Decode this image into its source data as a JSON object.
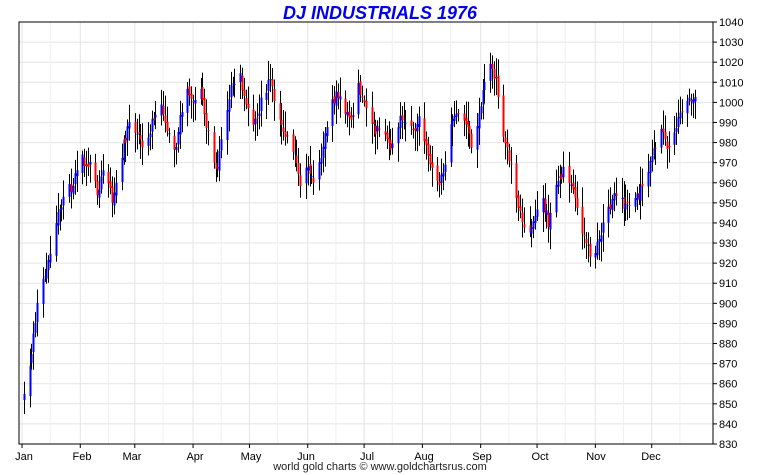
{
  "chart_data": {
    "type": "ohlc",
    "title": "DJ INDUSTRIALS 1976",
    "credit": "world gold charts © www.goldchartsrus.com",
    "y_axis": {
      "min": 830,
      "max": 1040,
      "step": 10,
      "side": "right",
      "ticks": [
        830,
        840,
        850,
        860,
        870,
        880,
        890,
        900,
        910,
        920,
        930,
        940,
        950,
        960,
        970,
        980,
        990,
        1000,
        1010,
        1020,
        1030,
        1040
      ]
    },
    "x_axis": {
      "months": [
        "Jan",
        "Feb",
        "Mar",
        "Apr",
        "May",
        "Jun",
        "Jul",
        "Aug",
        "Sep",
        "Oct",
        "Nov",
        "Dec"
      ]
    },
    "grid": true,
    "colors": {
      "title": "#0000ee",
      "up_bar": "#0000ff",
      "down_bar": "#ff0000",
      "wick": "#000000",
      "grid": "#e4e4e4"
    },
    "series": [
      {
        "close_path": [
          {
            "d": 1,
            "c": 852
          },
          {
            "d": 3,
            "c": 860
          },
          {
            "d": 6,
            "c": 885
          },
          {
            "d": 9,
            "c": 905
          },
          {
            "d": 13,
            "c": 915
          },
          {
            "d": 16,
            "c": 930
          },
          {
            "d": 20,
            "c": 948
          },
          {
            "d": 24,
            "c": 955
          },
          {
            "d": 28,
            "c": 962
          },
          {
            "d": 32,
            "c": 972
          },
          {
            "d": 36,
            "c": 968
          },
          {
            "d": 40,
            "c": 955
          },
          {
            "d": 44,
            "c": 970
          },
          {
            "d": 48,
            "c": 950
          },
          {
            "d": 53,
            "c": 975
          },
          {
            "d": 57,
            "c": 990
          },
          {
            "d": 61,
            "c": 985
          },
          {
            "d": 65,
            "c": 975
          },
          {
            "d": 69,
            "c": 990
          },
          {
            "d": 73,
            "c": 1000
          },
          {
            "d": 77,
            "c": 985
          },
          {
            "d": 82,
            "c": 978
          },
          {
            "d": 87,
            "c": 1010
          },
          {
            "d": 91,
            "c": 1000
          },
          {
            "d": 95,
            "c": 1005
          },
          {
            "d": 99,
            "c": 985
          },
          {
            "d": 103,
            "c": 965
          },
          {
            "d": 107,
            "c": 985
          },
          {
            "d": 111,
            "c": 1008
          },
          {
            "d": 116,
            "c": 1012
          },
          {
            "d": 120,
            "c": 995
          },
          {
            "d": 124,
            "c": 990
          },
          {
            "d": 128,
            "c": 1005
          },
          {
            "d": 132,
            "c": 1010
          },
          {
            "d": 136,
            "c": 992
          },
          {
            "d": 140,
            "c": 985
          },
          {
            "d": 144,
            "c": 978
          },
          {
            "d": 148,
            "c": 960
          },
          {
            "d": 152,
            "c": 970
          },
          {
            "d": 155,
            "c": 958
          },
          {
            "d": 159,
            "c": 975
          },
          {
            "d": 163,
            "c": 995
          },
          {
            "d": 167,
            "c": 1005
          },
          {
            "d": 171,
            "c": 998
          },
          {
            "d": 175,
            "c": 992
          },
          {
            "d": 179,
            "c": 1010
          },
          {
            "d": 183,
            "c": 995
          },
          {
            "d": 188,
            "c": 985
          },
          {
            "d": 192,
            "c": 988
          },
          {
            "d": 196,
            "c": 978
          },
          {
            "d": 200,
            "c": 990
          },
          {
            "d": 204,
            "c": 992
          },
          {
            "d": 208,
            "c": 985
          },
          {
            "d": 212,
            "c": 992
          },
          {
            "d": 216,
            "c": 972
          },
          {
            "d": 220,
            "c": 958
          },
          {
            "d": 224,
            "c": 965
          },
          {
            "d": 228,
            "c": 988
          },
          {
            "d": 232,
            "c": 995
          },
          {
            "d": 236,
            "c": 990
          },
          {
            "d": 240,
            "c": 975
          },
          {
            "d": 244,
            "c": 1000
          },
          {
            "d": 248,
            "c": 1020
          },
          {
            "d": 252,
            "c": 1012
          },
          {
            "d": 256,
            "c": 985
          },
          {
            "d": 260,
            "c": 968
          },
          {
            "d": 264,
            "c": 950
          },
          {
            "d": 268,
            "c": 935
          },
          {
            "d": 272,
            "c": 940
          },
          {
            "d": 276,
            "c": 955
          },
          {
            "d": 280,
            "c": 940
          },
          {
            "d": 284,
            "c": 958
          },
          {
            "d": 288,
            "c": 965
          },
          {
            "d": 292,
            "c": 960
          },
          {
            "d": 296,
            "c": 942
          },
          {
            "d": 300,
            "c": 928
          },
          {
            "d": 304,
            "c": 922
          },
          {
            "d": 308,
            "c": 935
          },
          {
            "d": 312,
            "c": 948
          },
          {
            "d": 316,
            "c": 955
          },
          {
            "d": 320,
            "c": 950
          },
          {
            "d": 324,
            "c": 945
          },
          {
            "d": 328,
            "c": 955
          },
          {
            "d": 332,
            "c": 965
          },
          {
            "d": 336,
            "c": 975
          },
          {
            "d": 340,
            "c": 985
          },
          {
            "d": 344,
            "c": 975
          },
          {
            "d": 348,
            "c": 990
          },
          {
            "d": 352,
            "c": 998
          },
          {
            "d": 355,
            "c": 1002
          }
        ]
      }
    ]
  }
}
